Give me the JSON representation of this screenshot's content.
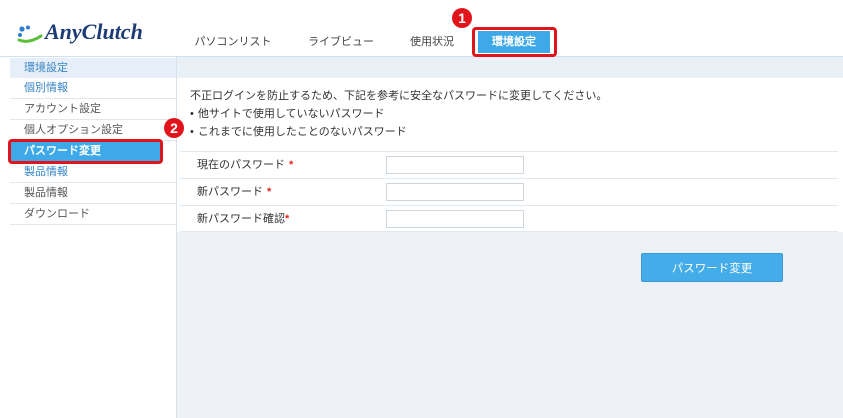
{
  "colors": {
    "accent": "#3ea9e8",
    "annotation": "#e1141c",
    "link": "#3784c6",
    "required_mark": "#e0262b",
    "text": "#333333"
  },
  "header": {
    "logo": {
      "icon": "anyclutch-logo-icon",
      "text": "AnyClutch"
    },
    "tabs": [
      {
        "label": "パソコンリスト",
        "active": false
      },
      {
        "label": "ライブビュー",
        "active": false
      },
      {
        "label": "使用状況",
        "active": false
      },
      {
        "label": "環境設定",
        "active": true
      }
    ]
  },
  "sidebar": {
    "title": "環境設定",
    "sections": [
      {
        "heading": "個別情報",
        "items": [
          {
            "label": "アカウント設定",
            "active": false
          },
          {
            "label": "個人オプション設定",
            "active": false
          },
          {
            "label": "パスワード変更",
            "active": true
          }
        ]
      },
      {
        "heading": "製品情報",
        "items": [
          {
            "label": "製品情報",
            "active": false
          },
          {
            "label": "ダウンロード",
            "active": false
          }
        ]
      }
    ]
  },
  "main": {
    "intro": "不正ログインを防止するため、下記を参考に安全なパスワードに変更してください。",
    "bullets": [
      "他サイトで使用していないパスワード",
      "これまでに使用したことのないパスワード"
    ],
    "form": {
      "fields": [
        {
          "label": "現在のパスワード",
          "required_mark": "*",
          "value": ""
        },
        {
          "label": "新パスワード",
          "required_mark": "*",
          "value": ""
        },
        {
          "label": "新パスワード確認",
          "required_mark": "*",
          "value": ""
        }
      ],
      "submit_label": "パスワード変更"
    }
  },
  "annotations": [
    {
      "number": "1"
    },
    {
      "number": "2"
    }
  ]
}
